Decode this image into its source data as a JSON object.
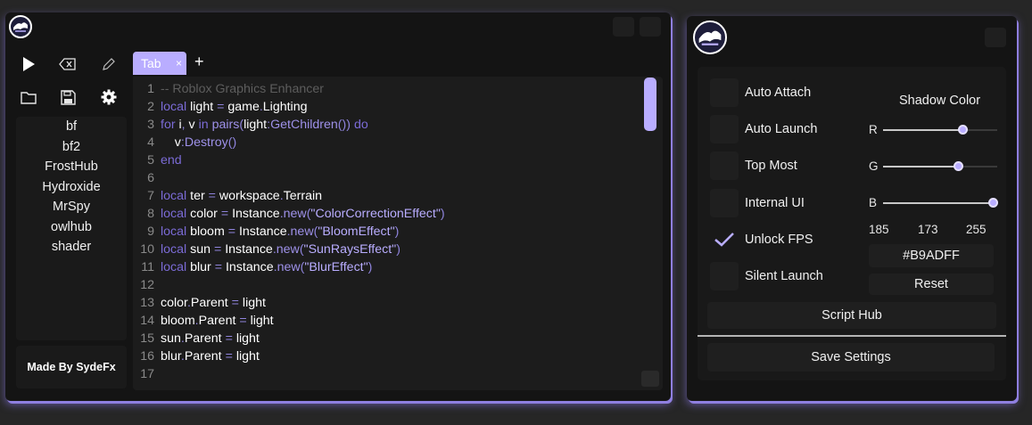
{
  "editor": {
    "tab_label": "Tab",
    "tab_close": "×",
    "add_tab": "+",
    "scripts": [
      "bf",
      "bf2",
      "FrostHub",
      "Hydroxide",
      "MrSpy",
      "owlhub",
      "shader"
    ],
    "credit": "Made By SydeFx",
    "line_numbers": [
      "1",
      "2",
      "3",
      "4",
      "5",
      "6",
      "7",
      "8",
      "9",
      "10",
      "11",
      "12",
      "13",
      "14",
      "15",
      "16",
      "17"
    ],
    "code": [
      "-- Roblox Graphics Enhancer",
      "local light = game.Lighting",
      "for i, v in pairs(light:GetChildren()) do",
      "    v:Destroy()",
      "end",
      "",
      "local ter = workspace.Terrain",
      "local color = Instance.new(\"ColorCorrectionEffect\")",
      "local bloom = Instance.new(\"BloomEffect\")",
      "local sun = Instance.new(\"SunRaysEffect\")",
      "local blur = Instance.new(\"BlurEffect\")",
      "",
      "color.Parent = light",
      "bloom.Parent = light",
      "sun.Parent = light",
      "blur.Parent = light"
    ]
  },
  "settings": {
    "options": [
      {
        "label": "Auto Attach",
        "checked": false
      },
      {
        "label": "Auto Launch",
        "checked": false
      },
      {
        "label": "Top Most",
        "checked": false
      },
      {
        "label": "Internal UI",
        "checked": false
      },
      {
        "label": "Unlock FPS",
        "checked": true
      },
      {
        "label": "Silent Launch",
        "checked": false
      }
    ],
    "shadow_title": "Shadow Color",
    "r_label": "R",
    "g_label": "G",
    "b_label": "B",
    "r_value": "185",
    "g_value": "173",
    "b_value": "255",
    "hex": "#B9ADFF",
    "reset": "Reset",
    "script_hub": "Script Hub",
    "save_settings": "Save Settings",
    "accent_color": "#B9ADFF"
  }
}
